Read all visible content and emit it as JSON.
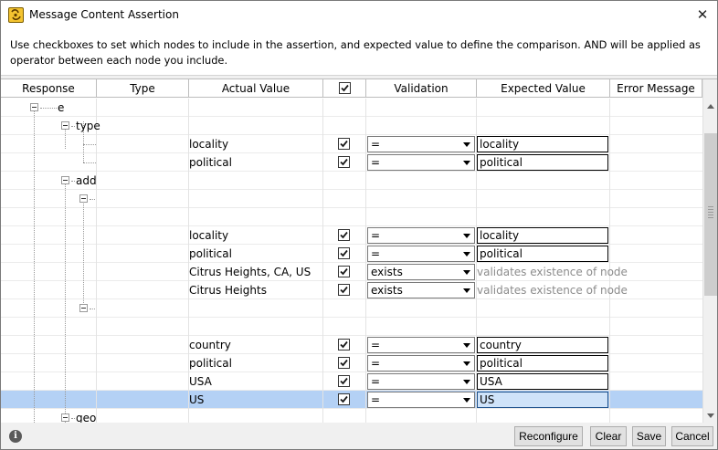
{
  "window": {
    "title": "Message Content Assertion",
    "description": "Use checkboxes to set which nodes to include in the assertion, and expected value to define the comparison. AND will be applied as operator between each node you include."
  },
  "columns": {
    "response": "Response",
    "type": "Type",
    "actual_value": "Actual Value",
    "validation": "Validation",
    "expected_value": "Expected Value",
    "error_message": "Error Message"
  },
  "tree": {
    "e": "e",
    "type": "type",
    "add": "add",
    "geo": "geo"
  },
  "rows": [
    {
      "actual": "",
      "checked": null,
      "validation": "",
      "expected": "",
      "placeholder": ""
    },
    {
      "actual": "",
      "checked": null,
      "validation": "",
      "expected": "",
      "placeholder": ""
    },
    {
      "actual": "locality",
      "checked": true,
      "validation": "=",
      "expected": "locality",
      "placeholder": ""
    },
    {
      "actual": "political",
      "checked": true,
      "validation": "=",
      "expected": "political",
      "placeholder": ""
    },
    {
      "actual": "",
      "checked": null,
      "validation": "",
      "expected": "",
      "placeholder": ""
    },
    {
      "actual": "",
      "checked": null,
      "validation": "",
      "expected": "",
      "placeholder": ""
    },
    {
      "actual": "",
      "checked": null,
      "validation": "",
      "expected": "",
      "placeholder": ""
    },
    {
      "actual": "locality",
      "checked": true,
      "validation": "=",
      "expected": "locality",
      "placeholder": ""
    },
    {
      "actual": "political",
      "checked": true,
      "validation": "=",
      "expected": "political",
      "placeholder": ""
    },
    {
      "actual": "Citrus Heights, CA, US",
      "checked": true,
      "validation": "exists",
      "expected": "",
      "placeholder": "validates existence of node"
    },
    {
      "actual": "Citrus Heights",
      "checked": true,
      "validation": "exists",
      "expected": "",
      "placeholder": "validates existence of node"
    },
    {
      "actual": "",
      "checked": null,
      "validation": "",
      "expected": "",
      "placeholder": ""
    },
    {
      "actual": "",
      "checked": null,
      "validation": "",
      "expected": "",
      "placeholder": ""
    },
    {
      "actual": "country",
      "checked": true,
      "validation": "=",
      "expected": "country",
      "placeholder": ""
    },
    {
      "actual": "political",
      "checked": true,
      "validation": "=",
      "expected": "political",
      "placeholder": ""
    },
    {
      "actual": "USA",
      "checked": true,
      "validation": "=",
      "expected": "USA",
      "placeholder": ""
    },
    {
      "actual": "US",
      "checked": true,
      "validation": "=",
      "expected": "US",
      "placeholder": "",
      "selected": true
    },
    {
      "actual": "",
      "checked": null,
      "validation": "",
      "expected": "",
      "placeholder": ""
    }
  ],
  "buttons": {
    "reconfigure": "Reconfigure",
    "clear": "Clear",
    "save": "Save",
    "cancel": "Cancel"
  },
  "icons": {
    "app": "app-icon",
    "close": "close-icon",
    "info": "info-icon"
  },
  "colors": {
    "selected_row": "#b4d1f5",
    "checkbox_check": "#1a1a1a",
    "placeholder_text": "#8c8c8c"
  }
}
